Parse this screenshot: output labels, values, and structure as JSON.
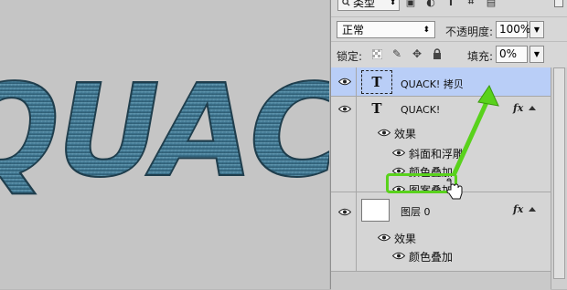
{
  "canvas": {
    "artwork_text": "QUAC"
  },
  "panel": {
    "filter_kind": "类型",
    "filter_icons": [
      "image-filter-icon",
      "adjustment-filter-icon",
      "type-filter-icon",
      "shape-filter-icon",
      "smart-object-filter-icon"
    ],
    "blend_mode": "正常",
    "opacity_label": "不透明度:",
    "opacity_value": "100%",
    "lock_label": "锁定:",
    "fill_label": "填充:",
    "fill_value": "0%",
    "layers": [
      {
        "name": "QUACK! 拷贝",
        "thumb": "T",
        "selected": true
      },
      {
        "name": "QUACK!",
        "thumb": "T",
        "fx": "fx",
        "effects_label": "效果",
        "effects": [
          "斜面和浮雕",
          "颜色叠加",
          "图案叠加"
        ]
      },
      {
        "name": "图层 0",
        "fx": "fx",
        "effects_label": "效果",
        "effects": [
          "颜色叠加"
        ]
      }
    ]
  },
  "colors": {
    "highlight_green": "#59d21c",
    "selected_row": "#b9cef7"
  }
}
